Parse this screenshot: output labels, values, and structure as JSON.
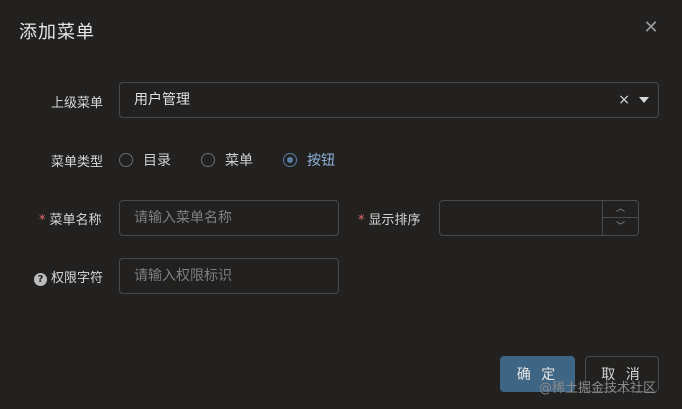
{
  "dialog": {
    "title": "添加菜单",
    "close_icon": "close-icon"
  },
  "form": {
    "parent_menu": {
      "label": "上级菜单",
      "value": "用户管理",
      "clear_glyph": "×"
    },
    "menu_type": {
      "label": "菜单类型",
      "options": [
        {
          "label": "目录",
          "checked": false
        },
        {
          "label": "菜单",
          "checked": false
        },
        {
          "label": "按钮",
          "checked": true
        }
      ]
    },
    "menu_name": {
      "required_mark": "*",
      "label": "菜单名称",
      "value": "",
      "placeholder": "请输入菜单名称"
    },
    "display_order": {
      "required_mark": "*",
      "label": "显示排序",
      "value": ""
    },
    "permission": {
      "help_glyph": "?",
      "label": "权限字符",
      "value": "",
      "placeholder": "请输入权限标识"
    }
  },
  "footer": {
    "confirm_label": "确 定",
    "cancel_label": "取 消"
  },
  "watermark": "@稀土掘金技术社区",
  "colors": {
    "background": "#222120",
    "primary_button": "#3e6584",
    "radio_checked": "#5a7fa6",
    "required": "#e06b6b"
  }
}
